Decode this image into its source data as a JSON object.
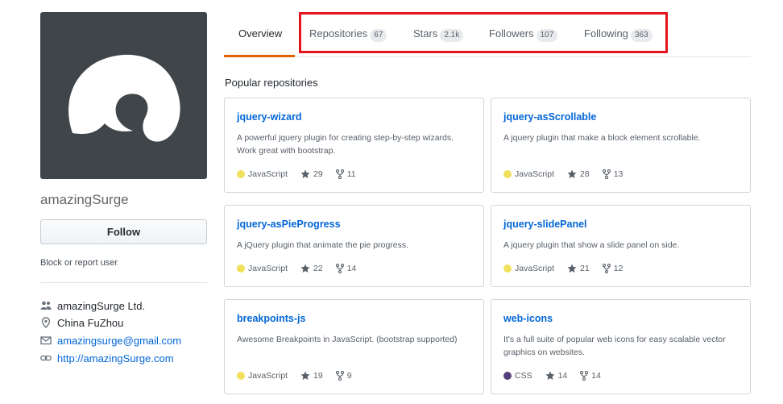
{
  "profile": {
    "username": "amazingSurge",
    "follow_label": "Follow",
    "block_label": "Block or report user",
    "details": [
      {
        "icon": "organization-icon",
        "text": "amazingSurge Ltd.",
        "link": false
      },
      {
        "icon": "location-icon",
        "text": "China FuZhou",
        "link": false
      },
      {
        "icon": "mail-icon",
        "text": "amazingsurge@gmail.com",
        "link": true
      },
      {
        "icon": "link-icon",
        "text": "http://amazingSurge.com",
        "link": true
      }
    ]
  },
  "tabs": [
    {
      "label": "Overview",
      "count": null,
      "active": true
    },
    {
      "label": "Repositories",
      "count": "67",
      "active": false
    },
    {
      "label": "Stars",
      "count": "2.1k",
      "active": false
    },
    {
      "label": "Followers",
      "count": "107",
      "active": false
    },
    {
      "label": "Following",
      "count": "363",
      "active": false
    }
  ],
  "popular": {
    "title": "Popular repositories",
    "repos": [
      {
        "name": "jquery-wizard",
        "desc": "A powerful jquery plugin for creating step-by-step wizards. Work great with bootstrap.",
        "lang": "JavaScript",
        "lang_color": "#f1e05a",
        "stars": "29",
        "forks": "11"
      },
      {
        "name": "jquery-asScrollable",
        "desc": "A jquery plugin that make a block element scrollable.",
        "lang": "JavaScript",
        "lang_color": "#f1e05a",
        "stars": "28",
        "forks": "13"
      },
      {
        "name": "jquery-asPieProgress",
        "desc": "A jQuery plugin that animate the pie progress.",
        "lang": "JavaScript",
        "lang_color": "#f1e05a",
        "stars": "22",
        "forks": "14"
      },
      {
        "name": "jquery-slidePanel",
        "desc": "A jquery plugin that show a slide panel on side.",
        "lang": "JavaScript",
        "lang_color": "#f1e05a",
        "stars": "21",
        "forks": "12"
      },
      {
        "name": "breakpoints-js",
        "desc": "Awesome Breakpoints in JavaScript. (bootstrap supported)",
        "lang": "JavaScript",
        "lang_color": "#f1e05a",
        "stars": "19",
        "forks": "9"
      },
      {
        "name": "web-icons",
        "desc": "It's a full suite of popular web icons for easy scalable vector graphics on websites.",
        "lang": "CSS",
        "lang_color": "#563d7c",
        "stars": "14",
        "forks": "14"
      }
    ]
  },
  "colors": {
    "accent": "#e36209",
    "link": "#0366d6",
    "highlight": "#e3141b"
  }
}
